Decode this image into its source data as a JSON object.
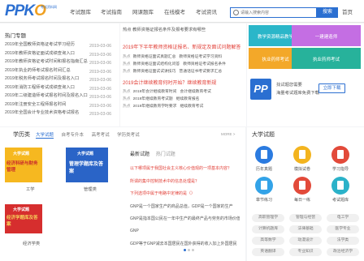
{
  "header": {
    "logo_main": "PPK",
    "logo_accent": "O",
    "logo_sub": "考试资料网",
    "nav": [
      "考试题库",
      "考试指南",
      "网课题库",
      "在线模考",
      "考试资讯"
    ],
    "search_placeholder": "请输入搜索内容",
    "search_button": "搜索",
    "top_link": "首页"
  },
  "news_top": [
    {
      "tag": "热点",
      "text": "成考专升本报名时间及报名入口2022年"
    }
  ],
  "hot_topics": {
    "title": "热门专题",
    "items": [
      {
        "text": "2019年全国教师资格证考试学习经历",
        "date": "2019-03-06"
      },
      {
        "text": "2019年教师资格证面试成绩查询入口",
        "date": "2019-03-06"
      },
      {
        "text": "2019年教师资格证考试时间和报名指南汇总",
        "date": "2019-03-06"
      },
      {
        "text": "2019年执业药师考试报名时间汇总",
        "date": "2019-03-06"
      },
      {
        "text": "2019年税务师考试报名时间及报名入口",
        "date": "2019-03-06"
      },
      {
        "text": "2019年消防工程师考试成绩查询入口",
        "date": "2019-03-06"
      },
      {
        "text": "2019年二级建造师考试报名时间及报名入口",
        "date": "2019-03-06"
      },
      {
        "text": "2019年注册安全工程师报名时间",
        "date": "2019-03-06"
      },
      {
        "text": "2019年全国会计专业技术资格考试报名",
        "date": "2019-03-06"
      }
    ]
  },
  "center_news": {
    "row1": [
      {
        "tag": "热点",
        "text": "教师资格证报名条件及报考要求有哪些"
      }
    ],
    "headline1": "2019年下半年教师资格证报名、新规定及面试问题解答",
    "list1": [
      {
        "tag": "热点",
        "text": "教师资格证面试真题汇总",
        "extra": "教师资格证考试学习资料"
      },
      {
        "tag": "热点",
        "text": "教师资格证面试结构化问答",
        "extra": "教师资格证考试报名条件"
      },
      {
        "tag": "热点",
        "text": "教师资格证面试试讲技巧",
        "extra": "普通话证书考试要求汇总"
      }
    ],
    "headline2": "2019会计继续教育何时开始？继续教育新规",
    "list2": [
      {
        "tag": "热点",
        "text": "2019年会计继续教育时间",
        "extra": "会计继续教育考试"
      },
      {
        "tag": "热点",
        "text": "2019年继续教育考试题",
        "extra": "继续教育报名"
      },
      {
        "tag": "热点",
        "text": "2019年继续教育学时要求",
        "extra": "继续教育考试"
      }
    ]
  },
  "right_cards": [
    {
      "label": "教学资源精品教学",
      "color": "#2bb6c9"
    },
    {
      "label": "一建建造师",
      "color": "#c46ee3"
    },
    {
      "label": "执业药师考试",
      "color": "#f3a829"
    },
    {
      "label": "执业药师考试",
      "color": "#27b29b"
    }
  ],
  "promo": {
    "line1": "找试题您需要",
    "line2": "海量考试题库免费下载",
    "button": "立即下载"
  },
  "category": {
    "title": "学历类",
    "tabs": [
      "大学试题",
      "自考专升本",
      "高考考试",
      "学历类考试"
    ],
    "more": "MORE >",
    "thumbs": [
      {
        "title": "大学试题",
        "big": "经济科研与财务管理",
        "caption": "工学",
        "bg": "#f6b820"
      },
      {
        "title": "大学试题",
        "big": "管理学题库及答案",
        "caption": "管理类",
        "bg": "#2a64c7"
      },
      {
        "title": "大学试题",
        "big": "经济学题库及答案",
        "caption": "经济学类",
        "bg": "#d62e2e"
      }
    ],
    "news_tabs": [
      "最新试题",
      "热门试题"
    ],
    "news": [
      {
        "text": "以下哪项属于我国社会主义核心价值观的一项基本内容？",
        "hot": true
      },
      {
        "text": "所谓的集中控制技术中的信息处理是？",
        "hot": true
      },
      {
        "text": "下列选项中属于电路中定律的是（）",
        "hot": true
      },
      {
        "text": "GNP是一个国家生产的商品总值，GDP是一个国家的生产",
        "hot": false
      },
      {
        "text": "GNP是指本国公民在一年中生产的最终产品与劳务的市场价值",
        "hot": false
      },
      {
        "text": "GNP",
        "hot": false
      },
      {
        "text": "GDP等于GNP减去本国居民在国外获得的收入加上外国居民",
        "hot": false
      }
    ]
  },
  "university": {
    "title": "大学试题",
    "icons": [
      {
        "label": "历年真题",
        "color": "#2b7be0"
      },
      {
        "label": "模拟试卷",
        "color": "#f3b41f"
      },
      {
        "label": "学习指导",
        "color": "#e24a3a"
      },
      {
        "label": "章节练习",
        "color": "#33a3e8"
      },
      {
        "label": "每日一练",
        "color": "#e24a3a"
      },
      {
        "label": "考试题库",
        "color": "#2bb2c9"
      }
    ],
    "tags": [
      "高职管理学",
      "管理与经营",
      "电工学",
      "计算机题库",
      "法律基础",
      "医学专业",
      "高等数学",
      "动漫设计",
      "法学类",
      "英语翻译",
      "专业知识",
      "政治经济学"
    ]
  }
}
